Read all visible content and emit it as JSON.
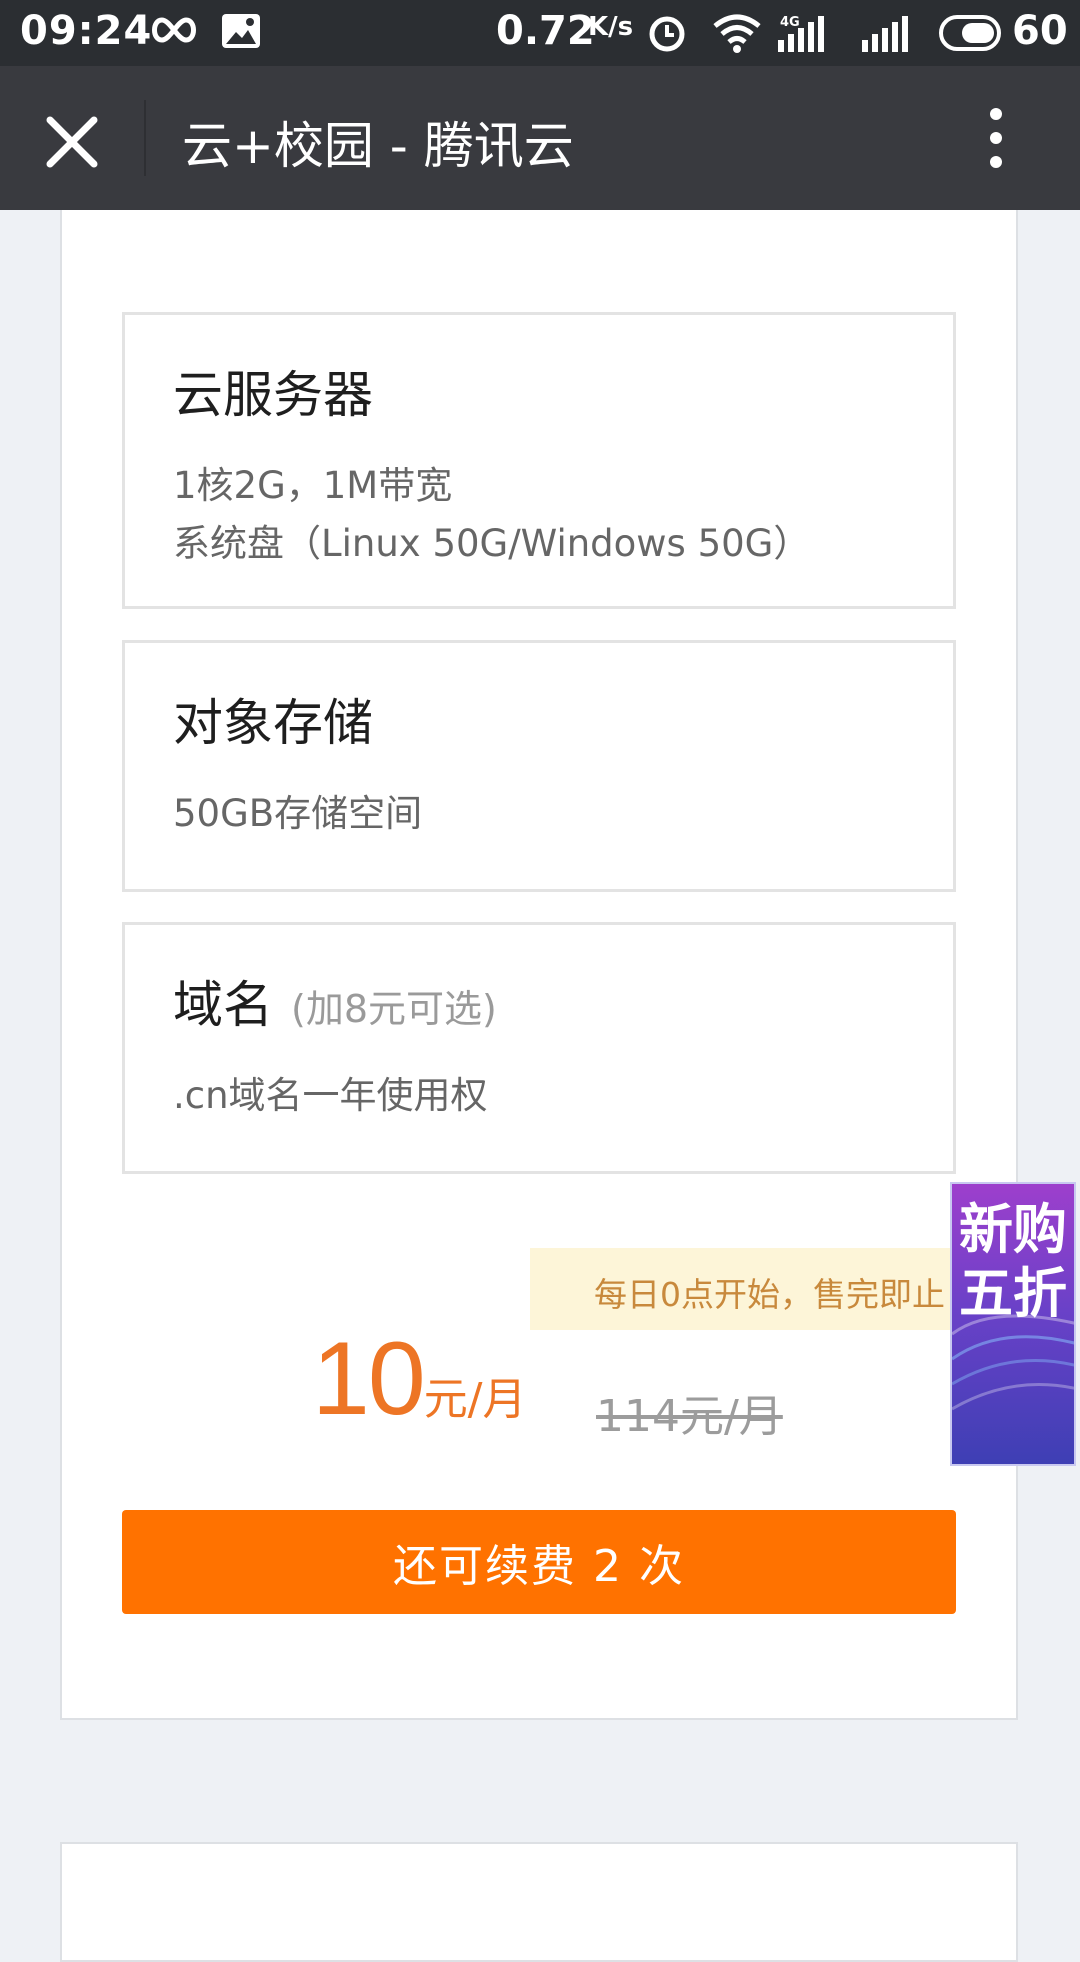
{
  "status_bar": {
    "time": "09:24",
    "net_speed": "0.72",
    "net_speed_unit": "K/s",
    "battery": "60",
    "network_type": "4G",
    "icons": [
      "infinity-icon",
      "image-icon",
      "alarm-icon",
      "wifi-icon",
      "signal-icon",
      "signal-icon",
      "battery-icon"
    ]
  },
  "nav": {
    "title": "云+校园 - 腾讯云",
    "close_icon": "close-icon",
    "more_icon": "more-vertical-icon"
  },
  "features": [
    {
      "title": "云服务器",
      "note": "",
      "lines": [
        "1核2G，1M带宽",
        "系统盘（Linux 50G/Windows 50G）"
      ]
    },
    {
      "title": "对象存储",
      "note": "",
      "lines": [
        "50GB存储空间"
      ]
    },
    {
      "title": "域名",
      "note": "(加8元可选)",
      "lines": [
        ".cn域名一年使用权"
      ]
    }
  ],
  "notice": "每日0点开始，售完即止",
  "price": {
    "amount": "10",
    "unit": "元/月",
    "original": "114元/月"
  },
  "renew_button": "还可续费 2 次",
  "promo": {
    "text": "新购五折"
  },
  "colors": {
    "accent": "#ff7200",
    "price": "#ed7525",
    "nav_bg": "#393a3f",
    "status_bg": "#2b2e32"
  }
}
